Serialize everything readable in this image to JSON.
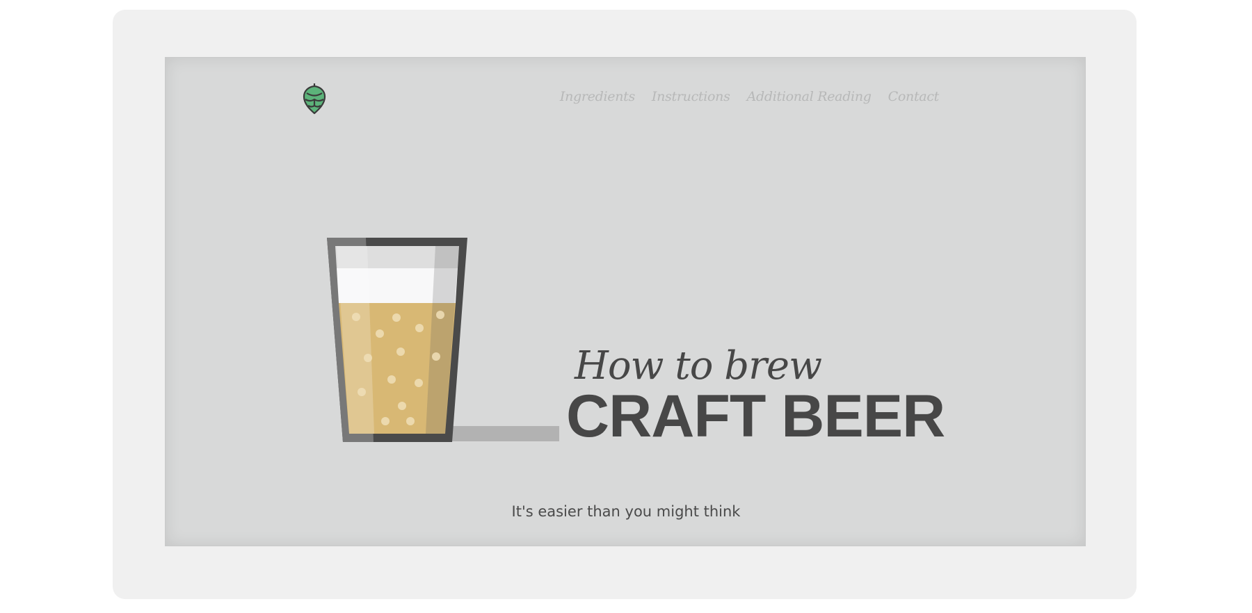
{
  "nav": {
    "items": [
      {
        "label": "Ingredients"
      },
      {
        "label": "Instructions"
      },
      {
        "label": "Additional Reading"
      },
      {
        "label": "Contact"
      }
    ]
  },
  "hero": {
    "headline_small": "How to brew",
    "headline_big": "CRAFT BEER",
    "tagline": "It's easier than you might think"
  },
  "icons": {
    "logo": "hop-icon",
    "illustration": "beer-glass-illustration"
  },
  "colors": {
    "screen_bg": "#d8d9d9",
    "frame_bg": "#f0f0f0",
    "headline": "#474747",
    "nav_text": "#b7b8b8",
    "hop_green": "#5cb37a",
    "beer": "#d8b874",
    "foam": "#f8f8f9"
  }
}
